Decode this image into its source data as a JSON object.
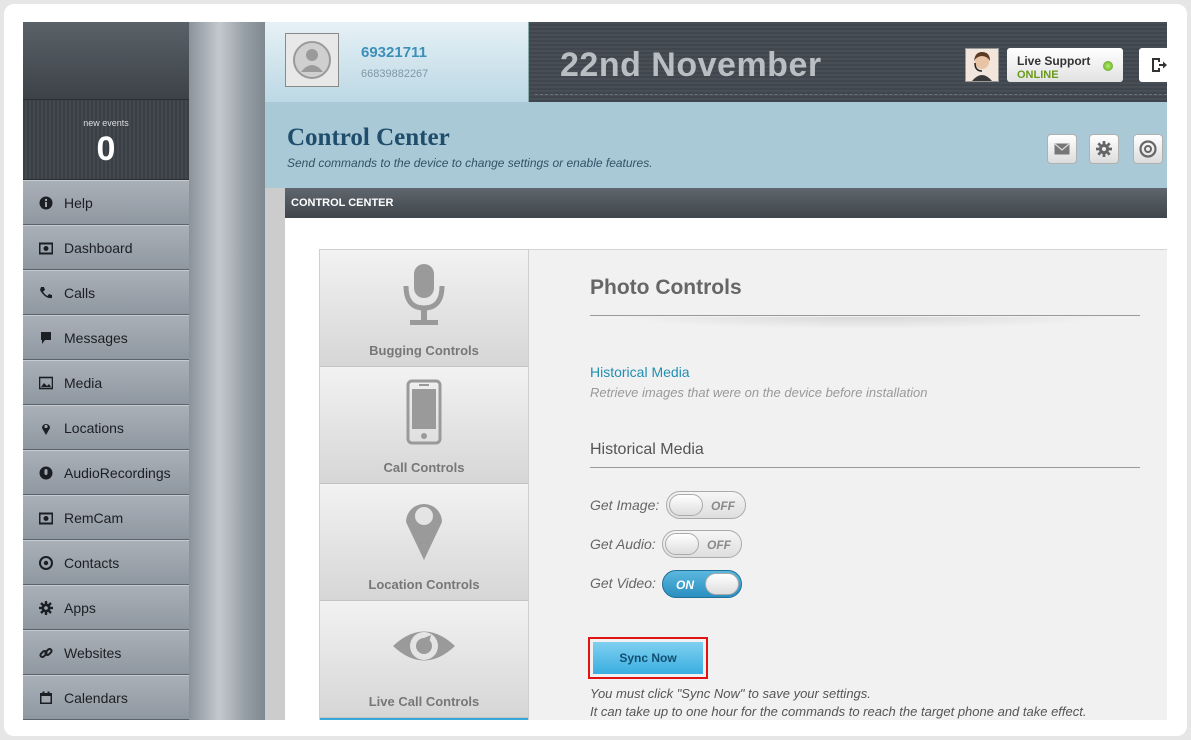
{
  "sidebar": {
    "events_label": "new events",
    "events_count": "0",
    "items": [
      {
        "label": "Help",
        "icon": "info-icon"
      },
      {
        "label": "Dashboard",
        "icon": "camera-icon"
      },
      {
        "label": "Calls",
        "icon": "phone-icon"
      },
      {
        "label": "Messages",
        "icon": "chat-icon"
      },
      {
        "label": "Media",
        "icon": "image-icon"
      },
      {
        "label": "Locations",
        "icon": "pin-icon"
      },
      {
        "label": "AudioRecordings",
        "icon": "mic-icon"
      },
      {
        "label": "RemCam",
        "icon": "camera-icon"
      },
      {
        "label": "Contacts",
        "icon": "contact-icon"
      },
      {
        "label": "Apps",
        "icon": "gear-icon"
      },
      {
        "label": "Websites",
        "icon": "link-icon"
      },
      {
        "label": "Calendars",
        "icon": "calendar-icon"
      }
    ]
  },
  "header": {
    "account_id": "69321711",
    "account_phone": "66839882267",
    "date": "22nd November",
    "support_label": "Live Support",
    "support_status": "ONLINE",
    "status_color": "#6a9a1a"
  },
  "page": {
    "title": "Control Center",
    "subtitle": "Send commands to the device to change settings or enable features.",
    "section_bar": "CONTROL CENTER"
  },
  "menu": [
    {
      "label": "Bugging Controls",
      "icon": "microphone-icon"
    },
    {
      "label": "Call Controls",
      "icon": "mobile-phone-icon"
    },
    {
      "label": "Location Controls",
      "icon": "map-pin-icon"
    },
    {
      "label": "Live Call Controls",
      "icon": "eye-icon"
    }
  ],
  "panel": {
    "title": "Photo Controls",
    "link": "Historical Media",
    "link_desc": "Retrieve images that were on the device before installation",
    "section": "Historical Media",
    "toggles": [
      {
        "label": "Get Image:",
        "state": "OFF"
      },
      {
        "label": "Get Audio:",
        "state": "OFF"
      },
      {
        "label": "Get Video:",
        "state": "ON"
      }
    ],
    "sync_label": "Sync Now",
    "note1": "You must click \"Sync Now\" to save your settings.",
    "note2": "It can take up to one hour for the commands to reach the target phone and take effect."
  }
}
